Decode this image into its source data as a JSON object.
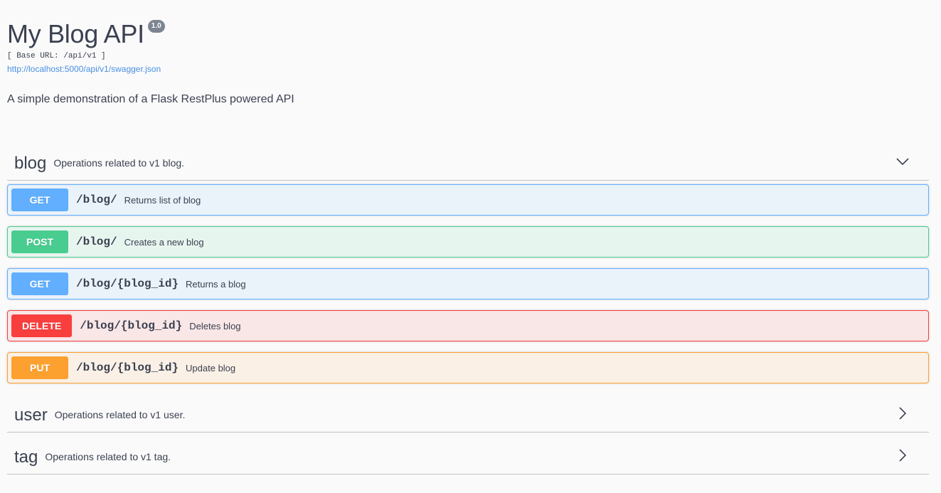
{
  "info": {
    "title": "My Blog API",
    "version": "1.0",
    "base_url": "[ Base URL: /api/v1 ]",
    "spec_link": "http://localhost:5000/api/v1/swagger.json",
    "description": "A simple demonstration of a Flask RestPlus powered API"
  },
  "tags": [
    {
      "name": "blog",
      "description": "Operations related to v1 blog.",
      "expanded": true,
      "icon": "chevron-down-icon",
      "operations": [
        {
          "method": "GET",
          "path": "/blog/",
          "summary": "Returns list of blog"
        },
        {
          "method": "POST",
          "path": "/blog/",
          "summary": "Creates a new blog"
        },
        {
          "method": "GET",
          "path": "/blog/{blog_id}",
          "summary": "Returns a blog"
        },
        {
          "method": "DELETE",
          "path": "/blog/{blog_id}",
          "summary": "Deletes blog"
        },
        {
          "method": "PUT",
          "path": "/blog/{blog_id}",
          "summary": "Update blog"
        }
      ]
    },
    {
      "name": "user",
      "description": "Operations related to v1 user.",
      "expanded": false,
      "icon": "chevron-right-icon"
    },
    {
      "name": "tag",
      "description": "Operations related to v1 tag.",
      "expanded": false,
      "icon": "chevron-right-icon"
    }
  ],
  "colors": {
    "get": "#61affe",
    "post": "#49cc90",
    "delete": "#f93e3e",
    "put": "#fca130",
    "link": "#4990e2",
    "text": "#3b4151"
  }
}
